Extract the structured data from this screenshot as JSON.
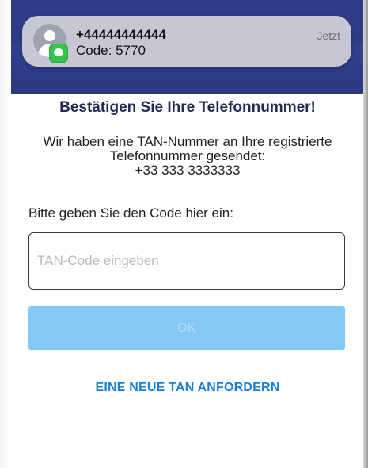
{
  "notification": {
    "sender": "+44444444444",
    "body": "Code: 5770",
    "time": "Jetzt",
    "avatar_icon": "contact-avatar-icon",
    "badge_icon": "messages-app-icon"
  },
  "dialog": {
    "title": "Bestätigen Sie Ihre Telefonnummer!",
    "info_line1": "Wir haben eine TAN-Nummer an Ihre registrierte",
    "info_line2": "Telefonnummer gesendet:",
    "phone_number": "+33 333 3333333",
    "prompt": "Bitte geben Sie den Code hier ein:",
    "tan_input": {
      "value": "",
      "placeholder": "TAN-Code eingeben"
    },
    "ok_label": "OK",
    "new_tan_label": "EINE NEUE TAN ANFORDERN"
  },
  "colors": {
    "header": "#2f3b86",
    "title": "#222a55",
    "ok_button_disabled": "#84c8f5",
    "link": "#1a7fd3",
    "message_badge": "#33c44a"
  }
}
